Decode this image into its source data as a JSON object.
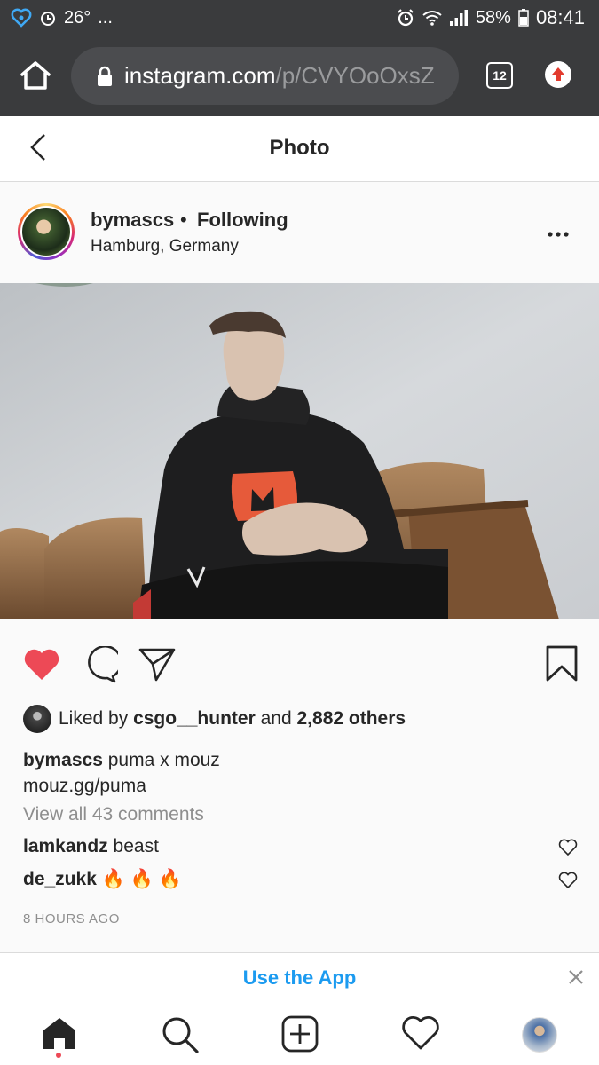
{
  "status_bar": {
    "temperature": "26°",
    "ellipsis": "...",
    "battery": "58%",
    "time": "08:41"
  },
  "browser": {
    "url_host": "instagram.com",
    "url_path": "/p/CVYOoOxsZ",
    "tab_count": "12"
  },
  "header": {
    "title": "Photo"
  },
  "post": {
    "username": "bymascs",
    "dot": "•",
    "follow_label": "Following",
    "location": "Hamburg, Germany"
  },
  "likes": {
    "prefix": "Liked by",
    "user": "csgo__hunter",
    "middle": "and",
    "others": "2,882 others"
  },
  "caption": {
    "username": "bymascs",
    "text": "puma x mouz",
    "link": "mouz.gg/puma"
  },
  "view_all_comments": "View all 43 comments",
  "comments": [
    {
      "user": "lamkandz",
      "text": "beast"
    },
    {
      "user": "de_zukk",
      "text": "🔥 🔥 🔥"
    }
  ],
  "timestamp": "8 HOURS AGO",
  "banner": {
    "text": "Use the App"
  },
  "colors": {
    "accent_blue": "#1c9bf0",
    "like_red": "#ed4956",
    "browser_bg": "#3a3b3d"
  },
  "icons": {
    "status": [
      "app-heart-icon",
      "alarm-icon",
      "wifi-icon",
      "signal-icon",
      "battery-icon"
    ],
    "browser": [
      "home-icon",
      "lock-icon",
      "tabs-icon",
      "upload-icon"
    ],
    "actions": [
      "heart-filled-icon",
      "comment-icon",
      "share-icon",
      "bookmark-icon"
    ],
    "nav": [
      "home-icon",
      "search-icon",
      "add-post-icon",
      "activity-heart-icon",
      "profile-avatar"
    ]
  }
}
